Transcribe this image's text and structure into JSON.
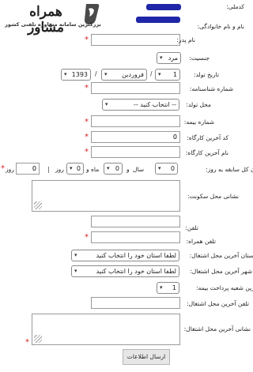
{
  "logo": {
    "title": "همراه مشاور",
    "tagline": "بزرگترین سامانه مشاوره تلفنی کشور"
  },
  "form": {
    "code_label": "کدملی:",
    "fullname_label": "نام و نام خانوادگی:",
    "father_label": "نام پدر:",
    "gender_label": "جنسیت:",
    "gender_value": "مرد",
    "birth_label": "تاریخ تولد:",
    "birth_day": "1",
    "birth_month": "فروردین",
    "birth_year": "1393",
    "date_sep": "/",
    "id_number_label": "شماره شناسنامه:",
    "birth_place_label": "محل تولد:",
    "birth_place_value": "-- انتخاب کنید --",
    "insurance_label": "شماره بیمه:",
    "workshop_code_label": "کد آخرین کارگاه:",
    "workshop_code_value": "0",
    "workshop_name_label": "نام آخرین کارگاه:",
    "experience_label": "میزان کل سابقه به روز:",
    "exp_year_value": "0",
    "exp_year_unit": "سال",
    "and_word": "و",
    "exp_month_value": "0",
    "exp_month_unit": "ماه",
    "exp_day_value": "0",
    "exp_day_unit": "روز",
    "or_sep": "|",
    "exp_total_value": "0",
    "exp_total_unit": "روز",
    "address_label": "نشانی محل سکونت:",
    "phone_label": "تلفن:",
    "mobile_label": "تلفن همراه:",
    "work_province_label": "استان آخرین محل اشتغال:",
    "work_province_value": "لطفا استان خود را انتخاب کنید",
    "work_city_label": "شهر آخرین محل اشتغال:",
    "work_city_value": "لطفا استان خود را انتخاب کنید",
    "branch_label": "آخرین شعبه پرداخت بیمه:",
    "branch_value": "1",
    "work_phone_label": "تلفن آخرین محل اشتغال:",
    "work_address_label": "نشانی آخرین محل اشتغال:",
    "submit_label": "ارسال اطلاعات",
    "required_mark": "*"
  }
}
